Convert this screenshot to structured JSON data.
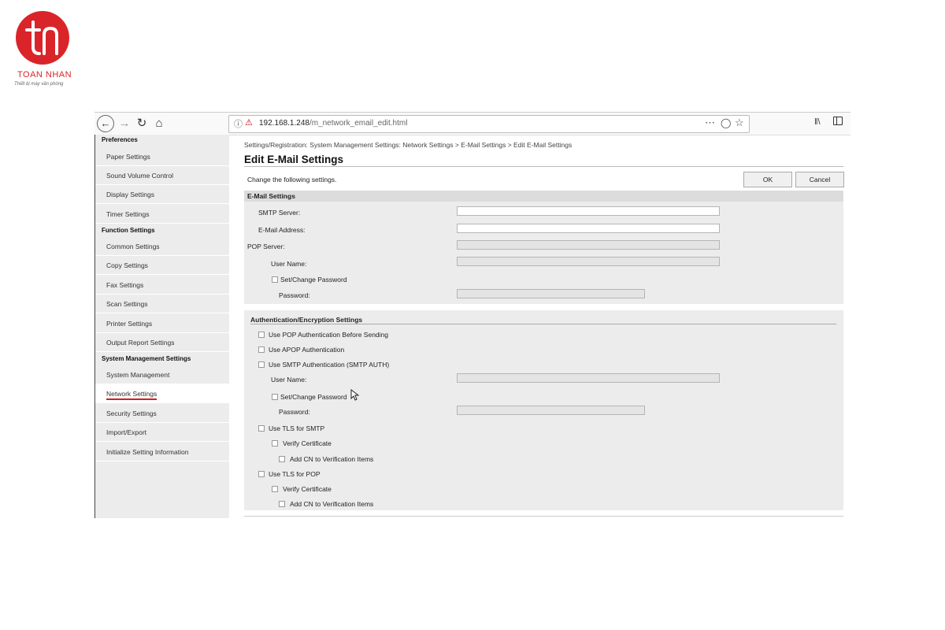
{
  "brand": {
    "name": "TOAN NHAN",
    "tagline": "Thiết bị máy văn phòng",
    "color": "#d9252a"
  },
  "browser": {
    "url_host": "192.168.1.248",
    "url_path": "/m_network_email_edit.html",
    "icons": [
      "back-icon",
      "forward-icon",
      "reload-icon",
      "home-icon",
      "info-icon",
      "insecure-lock-icon",
      "more-icon",
      "pocket-icon",
      "bookmark-star-icon",
      "library-icon",
      "sidebar-toggle-icon"
    ]
  },
  "sidebar": {
    "categories": [
      "Preferences",
      "Function Settings",
      "System Management Settings"
    ],
    "preferences": [
      "Paper Settings",
      "Sound Volume Control",
      "Display Settings",
      "Timer Settings"
    ],
    "function": [
      "Common Settings",
      "Copy Settings",
      "Fax Settings",
      "Scan Settings",
      "Printer Settings",
      "Output Report Settings"
    ],
    "system": [
      "System Management",
      "Network Settings",
      "Security Settings",
      "Import/Export",
      "Initialize Setting Information"
    ],
    "active": "Network Settings",
    "active_underline_color": "#d01f1f"
  },
  "main": {
    "breadcrumb": "Settings/Registration: System Management Settings: Network Settings > E-Mail Settings > Edit E-Mail Settings",
    "title": "Edit E-Mail Settings",
    "instruction": "Change the following settings.",
    "ok_label": "OK",
    "cancel_label": "Cancel"
  },
  "email": {
    "header": "E-Mail Settings",
    "smtp_server": "SMTP Server:",
    "email_address": "E-Mail Address:",
    "pop_server": "POP Server:",
    "user_name": "User Name:",
    "set_change_password": "Set/Change Password",
    "password": "Password:"
  },
  "auth": {
    "header": "Authentication/Encryption Settings",
    "pop_before_send": "Use POP Authentication Before Sending",
    "apop": "Use APOP Authentication",
    "smtp_auth": "Use SMTP Authentication (SMTP AUTH)",
    "user_name": "User Name:",
    "set_change_password": "Set/Change Password",
    "password": "Password:",
    "tls_smtp": "Use TLS for SMTP",
    "verify_cert_1": "Verify Certificate",
    "add_cn_1": "Add CN to Verification Items",
    "tls_pop": "Use TLS for POP",
    "verify_cert_2": "Verify Certificate",
    "add_cn_2": "Add CN to Verification Items"
  }
}
